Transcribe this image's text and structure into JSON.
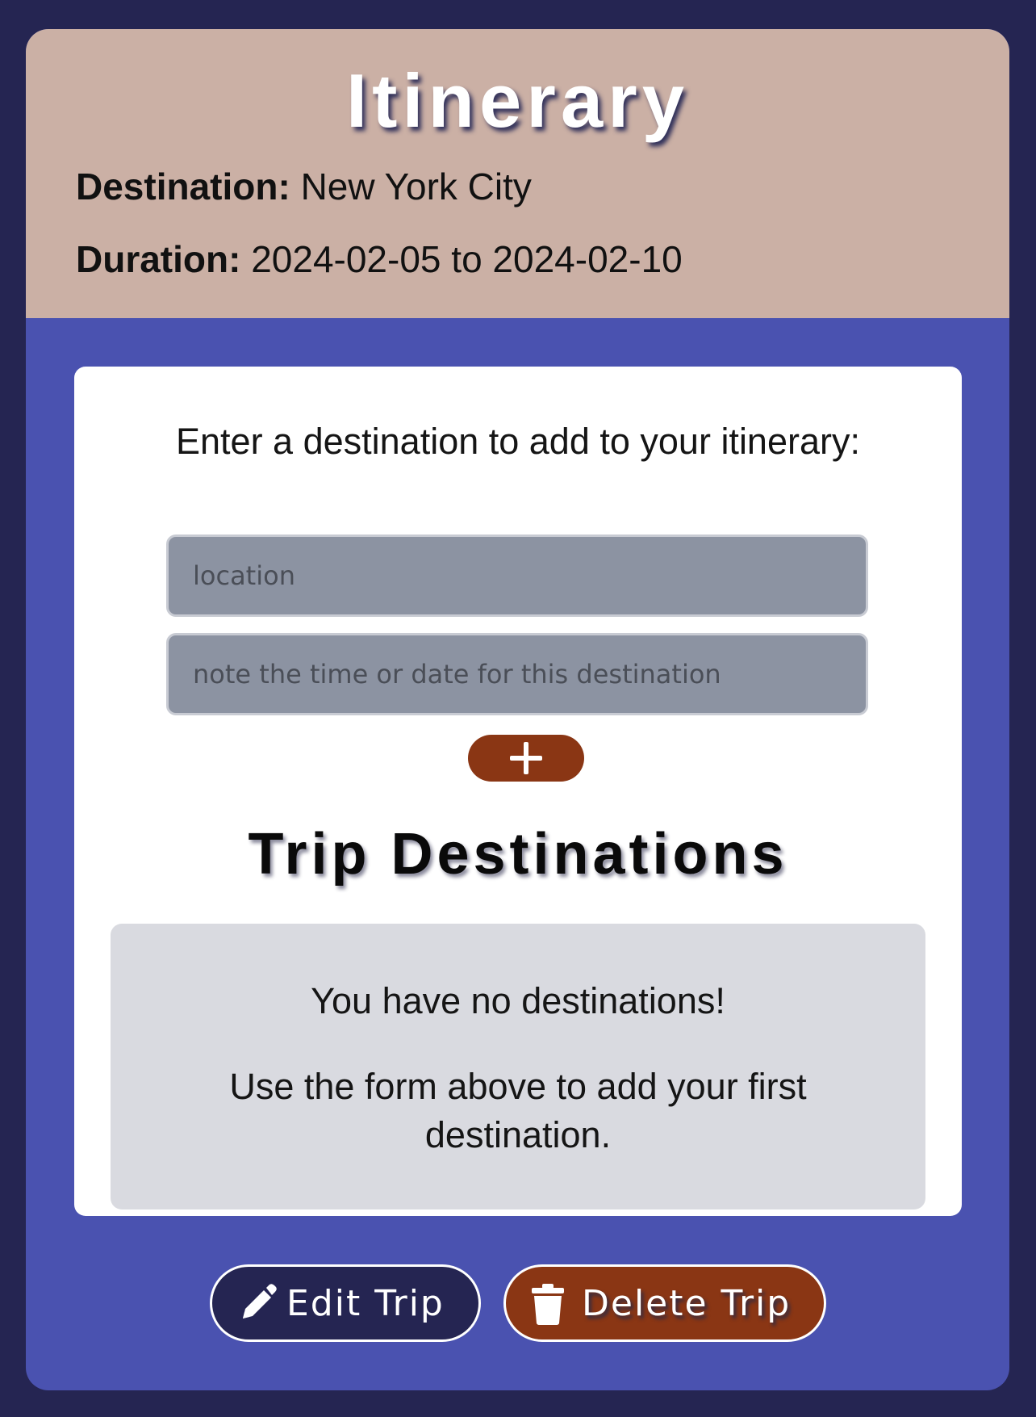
{
  "header": {
    "title": "Itinerary",
    "destination_label": "Destination:",
    "destination_value": "New York City",
    "duration_label": "Duration:",
    "duration_value": "2024-02-05 to 2024-02-10"
  },
  "form": {
    "prompt": "Enter a destination to add to your itinerary:",
    "location_placeholder": "location",
    "note_placeholder": "note the time or date for this destination",
    "add_icon": "plus-icon"
  },
  "destinations": {
    "heading": "Trip Destinations",
    "empty_title": "You have no destinations!",
    "empty_hint": "Use the form above to add your first destination."
  },
  "actions": {
    "edit_label": "Edit Trip",
    "edit_icon": "pencil-icon",
    "delete_label": "Delete Trip",
    "delete_icon": "trash-icon"
  },
  "colors": {
    "page_background": "#252552",
    "card_background": "#4a52b0",
    "header_background": "#cbb0a5",
    "accent_brown": "#8a3614",
    "input_background": "#8c93a2",
    "empty_box_background": "#d9dae0"
  }
}
